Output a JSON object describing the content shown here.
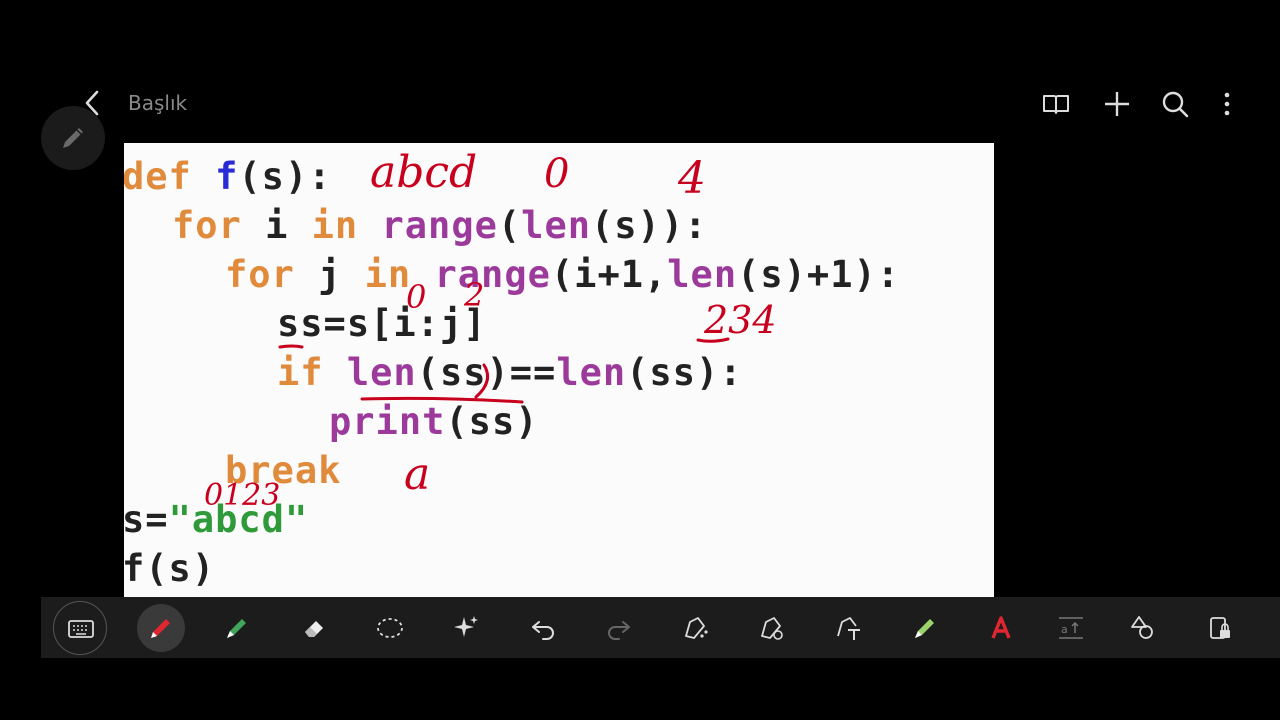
{
  "header": {
    "title": "Başlık",
    "icons": [
      "back-arrow-icon",
      "book-view-icon",
      "add-icon",
      "search-icon",
      "more-vertical-icon"
    ]
  },
  "code": {
    "lines": [
      [
        "def",
        " ",
        "f",
        "(s):"
      ],
      [
        "for",
        " i ",
        "in",
        " ",
        "range",
        "(",
        "len",
        "(s)):"
      ],
      [
        "for",
        " j ",
        "in",
        " ",
        "range",
        "(i+1,",
        "len",
        "(s)+1):"
      ],
      [
        "ss=s[i:j]"
      ],
      [
        "if",
        " ",
        "len",
        "(ss)==",
        "len",
        "(ss):"
      ],
      [
        "print",
        "(ss)"
      ],
      [
        "break"
      ],
      [
        "s=",
        "\"abcd\""
      ],
      [
        "f(s)"
      ]
    ]
  },
  "annotations": {
    "abcd": "abcd",
    "zero": "0",
    "four": "4",
    "i_val": "0",
    "j_val": "2",
    "nums": "234",
    "a": "a",
    "idx": "0123"
  },
  "toolbar": {
    "tools": [
      "keyboard-icon",
      "pen-icon",
      "highlighter-icon",
      "eraser-icon",
      "lasso-icon",
      "ai-sparkle-icon",
      "undo-icon",
      "redo-icon",
      "pen-settings-icon",
      "pen-settings-2-icon",
      "text-pen-icon",
      "highlighter-color-icon",
      "text-color-icon",
      "text-spacing-icon",
      "shapes-icon",
      "lock-icon"
    ]
  },
  "colors": {
    "ink": "#c8001e",
    "keyword": "#e08a3c",
    "builtin": "#9c3a9c",
    "function": "#2b2bd6",
    "string": "#2f9a3a"
  }
}
